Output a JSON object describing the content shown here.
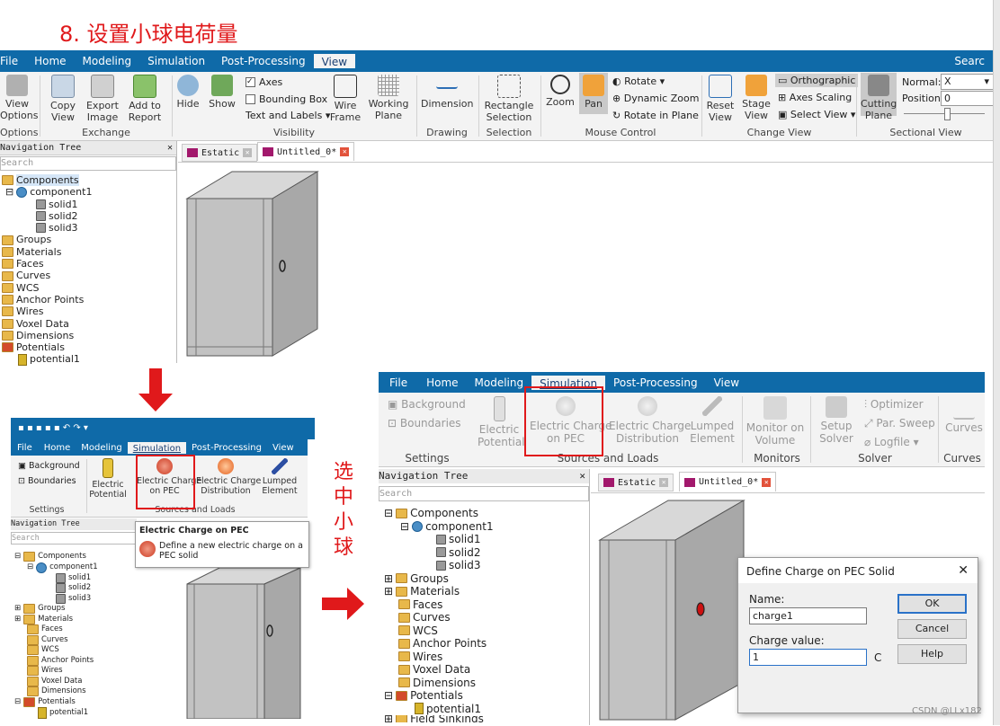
{
  "step_title": "8. 设置小球电荷量",
  "side_note": "选中小球",
  "watermark": "CSDN @LLx182",
  "top": {
    "menu": [
      "File",
      "Home",
      "Modeling",
      "Simulation",
      "Post-Processing",
      "View"
    ],
    "active_menu": "View",
    "search_label": "Searc",
    "view_options": "View\nOptions",
    "copy_view": "Copy\nView",
    "export_image": "Export\nImage",
    "add_report": "Add to\nReport",
    "hide": "Hide",
    "show": "Show",
    "axes": "Axes",
    "bounding_box": "Bounding Box",
    "text_labels": "Text and Labels",
    "wire_frame": "Wire\nFrame",
    "working_plane": "Working\nPlane",
    "dimension": "Dimension",
    "rect_selection": "Rectangle\nSelection",
    "zoom": "Zoom",
    "pan": "Pan",
    "rotate": "Rotate",
    "dynamic_zoom": "Dynamic Zoom",
    "rotate_in_plane": "Rotate in Plane",
    "reset_view": "Reset\nView",
    "stage_view": "Stage\nView",
    "orthographic": "Orthographic",
    "axes_scaling": "Axes Scaling",
    "select_view": "Select View",
    "cutting_plane": "Cutting\nPlane",
    "normal_label": "Normal:",
    "normal_value": "X",
    "position_label": "Position:",
    "position_value": "0",
    "groups": [
      "Options",
      "Exchange",
      "Visibility",
      "Drawing",
      "Selection",
      "Mouse Control",
      "Change View",
      "Sectional View"
    ],
    "nav_title": "Navigation Tree",
    "search_placeholder": "Search",
    "tree": [
      "Components",
      "component1",
      "solid1",
      "solid2",
      "solid3",
      "Groups",
      "Materials",
      "Faces",
      "Curves",
      "WCS",
      "Anchor Points",
      "Wires",
      "Voxel Data",
      "Dimensions",
      "Potentials",
      "potential1"
    ],
    "tabs": [
      "Estatic",
      "Untitled_0*"
    ]
  },
  "small": {
    "menu": [
      "File",
      "Home",
      "Modeling",
      "Simulation",
      "Post-Processing",
      "View"
    ],
    "active_menu": "Simulation",
    "background": "Background",
    "boundaries": "Boundaries",
    "electric_potential": "Electric\nPotential",
    "electric_charge_pec": "Electric Charge\non PEC",
    "electric_charge_dist": "Electric Charge\nDistribution",
    "lumped_element": "Lumped\nElement",
    "settings": "Settings",
    "sources_loads": "Sources and Loads",
    "nav_title": "Navigation Tree",
    "search_placeholder": "Search",
    "tooltip_title": "Electric Charge on PEC",
    "tooltip_text": "Define a new electric charge on a PEC solid",
    "tree": [
      "Components",
      "component1",
      "solid1",
      "solid2",
      "solid3",
      "Groups",
      "Materials",
      "Faces",
      "Curves",
      "WCS",
      "Anchor Points",
      "Wires",
      "Voxel Data",
      "Dimensions",
      "Potentials",
      "potential1"
    ]
  },
  "bottom": {
    "menu": [
      "File",
      "Home",
      "Modeling",
      "Simulation",
      "Post-Processing",
      "View"
    ],
    "active_menu": "Simulation",
    "background": "Background",
    "boundaries": "Boundaries",
    "electric_potential": "Electric\nPotential",
    "electric_charge_pec": "Electric Charge\non PEC",
    "electric_charge_dist": "Electric Charge\nDistribution",
    "lumped_element": "Lumped\nElement",
    "monitor_on_volume": "Monitor on\nVolume",
    "setup_solver": "Setup\nSolver",
    "optimizer": "Optimizer",
    "par_sweep": "Par. Sweep",
    "logfile": "Logfile",
    "curves": "Curves",
    "groups": [
      "Settings",
      "Sources and Loads",
      "Monitors",
      "Solver",
      "Curves"
    ],
    "nav_title": "Navigation Tree",
    "search_placeholder": "Search",
    "tabs": [
      "Estatic",
      "Untitled_0*"
    ],
    "tree": [
      "Components",
      "component1",
      "solid1",
      "solid2",
      "solid3",
      "Groups",
      "Materials",
      "Faces",
      "Curves",
      "WCS",
      "Anchor Points",
      "Wires",
      "Voxel Data",
      "Dimensions",
      "Potentials",
      "potential1",
      "Field Sinkings"
    ]
  },
  "dialog": {
    "title": "Define Charge on PEC Solid",
    "name_label": "Name:",
    "name_value": "charge1",
    "charge_label": "Charge value:",
    "charge_value": "1",
    "unit": "C",
    "ok": "OK",
    "cancel": "Cancel",
    "help": "Help"
  }
}
